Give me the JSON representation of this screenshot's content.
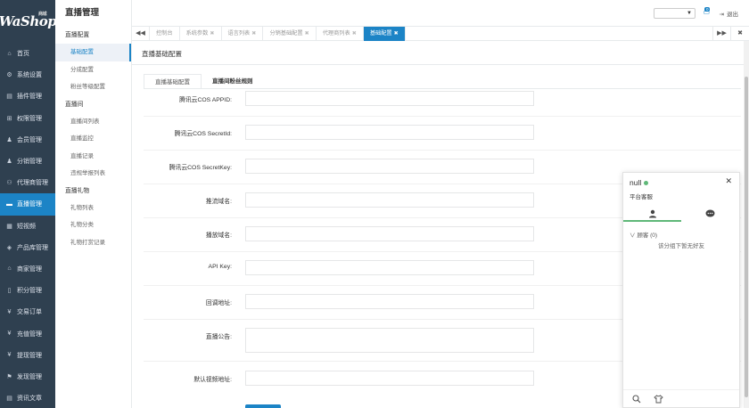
{
  "logo": {
    "text": "WaShop",
    "tag": "商城"
  },
  "nav": [
    {
      "label": "首页",
      "icon": "home-icon"
    },
    {
      "label": "系统设置",
      "icon": "gear-icon"
    },
    {
      "label": "插件管理",
      "icon": "plugin-icon"
    },
    {
      "label": "权限管理",
      "icon": "sitemap-icon"
    },
    {
      "label": "会员管理",
      "icon": "users-icon"
    },
    {
      "label": "分销管理",
      "icon": "users-icon"
    },
    {
      "label": "代理商管理",
      "icon": "agent-icon"
    },
    {
      "label": "直播管理",
      "icon": "video-icon"
    },
    {
      "label": "短视频",
      "icon": "film-icon"
    },
    {
      "label": "产品库管理",
      "icon": "cube-icon"
    },
    {
      "label": "商家管理",
      "icon": "bank-icon"
    },
    {
      "label": "积分管理",
      "icon": "file-icon"
    },
    {
      "label": "交易订单",
      "icon": "yen-icon"
    },
    {
      "label": "充值管理",
      "icon": "yen-icon"
    },
    {
      "label": "提现管理",
      "icon": "yen-icon"
    },
    {
      "label": "发现管理",
      "icon": "flag-icon"
    },
    {
      "label": "资讯文章",
      "icon": "news-icon"
    }
  ],
  "submenu": {
    "title": "直播管理",
    "entries": [
      {
        "type": "group",
        "label": "直播配置"
      },
      {
        "type": "item",
        "label": "基础配置",
        "active": true
      },
      {
        "type": "item",
        "label": "分成配置"
      },
      {
        "type": "item",
        "label": "粉丝等级配置"
      },
      {
        "type": "group",
        "label": "直播间"
      },
      {
        "type": "item",
        "label": "直播间列表"
      },
      {
        "type": "item",
        "label": "直播监控"
      },
      {
        "type": "item",
        "label": "直播记录"
      },
      {
        "type": "item",
        "label": "违规举报列表"
      },
      {
        "type": "group",
        "label": "直播礼物"
      },
      {
        "type": "item",
        "label": "礼物列表"
      },
      {
        "type": "item",
        "label": "礼物分类"
      },
      {
        "type": "item",
        "label": "礼物打赏记录"
      }
    ]
  },
  "topbar": {
    "select_value": "",
    "badge": "0",
    "logout": "退出"
  },
  "tabs": [
    {
      "label": "控制台",
      "closable": false
    },
    {
      "label": "系统参数",
      "closable": true
    },
    {
      "label": "语言列表",
      "closable": true
    },
    {
      "label": "分销基础配置",
      "closable": true
    },
    {
      "label": "代理商列表",
      "closable": true
    },
    {
      "label": "基础配置",
      "closable": true,
      "active": true
    }
  ],
  "content": {
    "breadcrumb": "直播基础配置",
    "form_tabs": [
      {
        "label": "直播基础配置",
        "active": true
      },
      {
        "label": "直播间粉丝规则",
        "active": false
      }
    ],
    "fields": [
      {
        "label": "腾讯云COS APPID:",
        "value": "",
        "type": "input"
      },
      {
        "label": "腾讯云COS SecretId:",
        "value": "",
        "type": "input"
      },
      {
        "label": "腾讯云COS SecretKey:",
        "value": "",
        "type": "input"
      },
      {
        "label": "推流域名:",
        "value": "",
        "type": "input"
      },
      {
        "label": "播放域名:",
        "value": "",
        "type": "input"
      },
      {
        "label": "API Key:",
        "value": "",
        "type": "input"
      },
      {
        "label": "回调地址:",
        "value": "",
        "type": "input"
      },
      {
        "label": "直播公告:",
        "value": "",
        "type": "textarea"
      },
      {
        "label": "默认视频地址:",
        "value": "",
        "type": "input"
      }
    ]
  },
  "chat": {
    "username": "null",
    "status": "平台客服",
    "group_label": "顾客",
    "group_count": "(0)",
    "empty_text": "该分组下暂无好友",
    "online_color": "#5fb878"
  },
  "colors": {
    "accent": "#1c84c6",
    "sidebar": "#2f4050"
  }
}
